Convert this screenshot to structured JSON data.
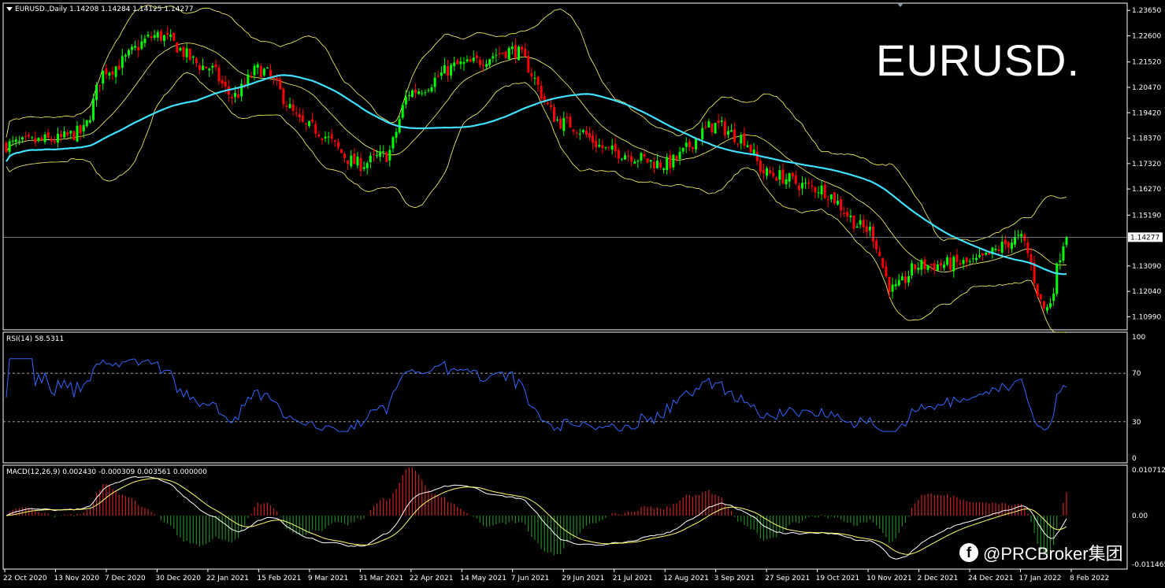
{
  "header": {
    "symbol_line": "EURUSD.,Daily  1.14208 1.14284 1.14125 1.14277",
    "rsi_line": "RSI(14) 58.5311",
    "macd_line": "MACD(12,26,9) 0.002430 -0.000309 0.003561 0.000000"
  },
  "overlay": {
    "title": "EURUSD.",
    "watermark": "@PRCBroker集团"
  },
  "colors": {
    "background": "#000000",
    "grid_border": "#ffffff",
    "bull_candle": "#00ff00",
    "bear_candle": "#ff0000",
    "ma_line": "#40e0ff",
    "bollinger": "#ffff66",
    "rsi_line": "#3366ff",
    "macd_line": "#ffffff",
    "signal_line": "#ffff66",
    "hist_pos": "#cc2222",
    "hist_neg": "#228822",
    "price_line": "#8899aa"
  },
  "chart_data": [
    {
      "type": "candlestick",
      "panel": "price",
      "ylim": [
        1.1045,
        1.2395
      ],
      "y_ticks": [
        "1.23650",
        "1.22600",
        "1.21520",
        "1.20470",
        "1.19420",
        "1.18370",
        "1.17320",
        "1.16270",
        "1.15190",
        "1.13090",
        "1.12040",
        "1.10990"
      ],
      "current_price_label": "1.14277",
      "current_price": 1.14277,
      "x_labels": [
        "22 Oct 2020",
        "13 Nov 2020",
        "7 Dec 2020",
        "30 Dec 2020",
        "22 Jan 2021",
        "15 Feb 2021",
        "9 Mar 2021",
        "31 Mar 2021",
        "22 Apr 2021",
        "14 May 2021",
        "7 Jun 2021",
        "29 Jun 2021",
        "21 Jul 2021",
        "12 Aug 2021",
        "3 Sep 2021",
        "27 Sep 2021",
        "19 Oct 2021",
        "10 Nov 2021",
        "2 Dec 2021",
        "24 Dec 2021",
        "17 Jan 2022",
        "8 Feb 2022"
      ],
      "close_anchors": [
        {
          "label": "22 Oct 2020",
          "value": 1.181
        },
        {
          "label": "13 Nov 2020",
          "value": 1.183
        },
        {
          "label": "7 Dec 2020",
          "value": 1.212
        },
        {
          "label": "30 Dec 2020",
          "value": 1.226
        },
        {
          "label": "22 Jan 2021",
          "value": 1.213
        },
        {
          "label": "15 Feb 2021",
          "value": 1.212
        },
        {
          "label": "9 Mar 2021",
          "value": 1.188
        },
        {
          "label": "31 Mar 2021",
          "value": 1.173
        },
        {
          "label": "22 Apr 2021",
          "value": 1.203
        },
        {
          "label": "14 May 2021",
          "value": 1.214
        },
        {
          "label": "7 Jun 2021",
          "value": 1.22
        },
        {
          "label": "29 Jun 2021",
          "value": 1.19
        },
        {
          "label": "21 Jul 2021",
          "value": 1.178
        },
        {
          "label": "12 Aug 2021",
          "value": 1.173
        },
        {
          "label": "3 Sep 2021",
          "value": 1.189
        },
        {
          "label": "27 Sep 2021",
          "value": 1.169
        },
        {
          "label": "19 Oct 2021",
          "value": 1.163
        },
        {
          "label": "10 Nov 2021",
          "value": 1.146
        },
        {
          "label": "2 Dec 2021",
          "value": 1.131
        },
        {
          "label": "24 Dec 2021",
          "value": 1.132
        },
        {
          "label": "17 Jan 2022",
          "value": 1.142
        },
        {
          "label": "8 Feb 2022",
          "value": 1.143
        }
      ],
      "close_anchors_extra": [
        {
          "after": "13 Nov 2020",
          "value": 1.186
        },
        {
          "after": "22 Jan 2021",
          "value": 1.201
        },
        {
          "after": "31 Mar 2021",
          "value": 1.1765
        },
        {
          "after": "3 Sep 2021",
          "value": 1.184
        },
        {
          "after": "10 Nov 2021",
          "value": 1.121
        },
        {
          "after": "17 Jan 2022",
          "value": 1.113
        },
        {
          "after": "8 Feb 2022",
          "value": 1.1428
        }
      ],
      "indicators": [
        "Moving Average",
        "Bollinger Bands"
      ]
    },
    {
      "type": "line",
      "panel": "rsi",
      "ylim": [
        0,
        100
      ],
      "y_ticks": [
        "100",
        "70",
        "30",
        "0"
      ],
      "levels": [
        70,
        30
      ],
      "series_value_last": 58.5311
    },
    {
      "type": "line+histogram",
      "panel": "macd",
      "ylim": [
        -0.011465,
        0.010712
      ],
      "y_ticks": [
        "0.010712",
        "0.00",
        "-0.011465"
      ]
    }
  ]
}
